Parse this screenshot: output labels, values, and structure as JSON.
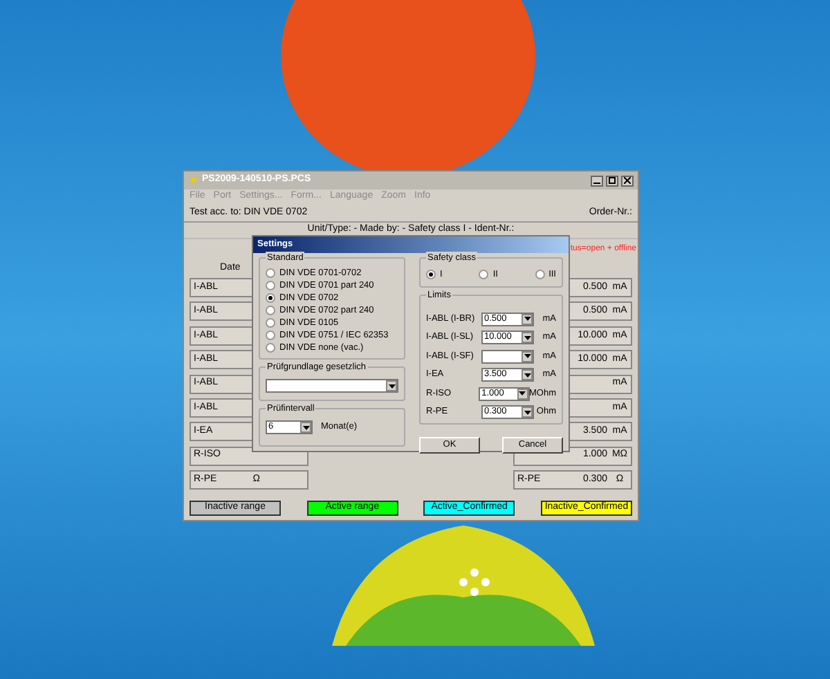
{
  "main_window": {
    "title": "PS2009-140510-PS.PCS",
    "menu": [
      "File",
      "Port",
      "Settings...",
      "Form...",
      "Language",
      "Zoom",
      "Info"
    ],
    "test_label": "Test acc. to: DIN VDE 0702",
    "order_label": "Order-Nr.:",
    "unit_line": "Unit/Type:  - Made by:  - Safety class I  - Ident-Nr.:",
    "status": "tus=open + offline",
    "date_header": "Date",
    "left_rows": [
      {
        "label": "I-ABL",
        "unit": ""
      },
      {
        "label": "I-ABL",
        "unit": ""
      },
      {
        "label": "I-ABL",
        "unit": ""
      },
      {
        "label": "I-ABL",
        "unit": ""
      },
      {
        "label": "I-ABL",
        "unit": ""
      },
      {
        "label": "I-ABL",
        "unit": ""
      },
      {
        "label": "I-EA",
        "unit": ""
      },
      {
        "label": "R-ISO",
        "unit": ""
      },
      {
        "label": "R-PE",
        "unit": "Ω"
      }
    ],
    "right_rows": [
      {
        "label": "",
        "value": "0.500",
        "unit": "mA"
      },
      {
        "label": "",
        "value": "0.500",
        "unit": "mA"
      },
      {
        "label": "",
        "value": "10.000",
        "unit": "mA"
      },
      {
        "label": "",
        "value": "10.000",
        "unit": "mA"
      },
      {
        "label": "",
        "value": "",
        "unit": "mA"
      },
      {
        "label": "",
        "value": "",
        "unit": "mA"
      },
      {
        "label": "",
        "value": "3.500",
        "unit": "mA"
      },
      {
        "label": "",
        "value": "1.000",
        "unit": "MΩ"
      },
      {
        "label": "R-PE",
        "value": "0.300",
        "unit": "Ω"
      }
    ],
    "legend": [
      {
        "label": "Inactive range",
        "color": "#c0c0c0"
      },
      {
        "label": "Active range",
        "color": "#00ff00"
      },
      {
        "label": "Active_Confirmed",
        "color": "#00ffff"
      },
      {
        "label": "Inactive_Confirmed",
        "color": "#ffff00"
      }
    ]
  },
  "dialog": {
    "title": "Settings",
    "standard": {
      "title": "Standard",
      "options": [
        {
          "label": "DIN VDE 0701-0702",
          "selected": false
        },
        {
          "label": "DIN VDE 0701 part 240",
          "selected": false
        },
        {
          "label": "DIN VDE 0702",
          "selected": true
        },
        {
          "label": "DIN VDE 0702 part 240",
          "selected": false
        },
        {
          "label": "DIN VDE 0105",
          "selected": false
        },
        {
          "label": "DIN VDE 0751 / IEC 62353",
          "selected": false
        },
        {
          "label": "DIN VDE none (vac.)",
          "selected": false
        }
      ]
    },
    "basis": {
      "title": "Prüfgrundlage gesetzlich"
    },
    "interval": {
      "title": "Prüfintervall",
      "value": "6",
      "unit": "Monat(e)"
    },
    "safety_class": {
      "title": "Safety class",
      "options": [
        {
          "label": "I",
          "selected": true
        },
        {
          "label": "II",
          "selected": false
        },
        {
          "label": "III",
          "selected": false
        }
      ]
    },
    "limits": {
      "title": "Limits",
      "rows": [
        {
          "label": "I-ABL (I-BR)",
          "value": "0.500",
          "unit": "mA"
        },
        {
          "label": "I-ABL (I-SL)",
          "value": "10.000",
          "unit": "mA"
        },
        {
          "label": "I-ABL (I-SF)",
          "value": "",
          "unit": "mA"
        },
        {
          "label": "I-EA",
          "value": "3.500",
          "unit": "mA"
        },
        {
          "label": "R-ISO",
          "value": "1.000",
          "unit": "MOhm"
        },
        {
          "label": "R-PE",
          "value": "0.300",
          "unit": "Ohm"
        }
      ]
    },
    "buttons": [
      "OK",
      "Cancel"
    ]
  }
}
